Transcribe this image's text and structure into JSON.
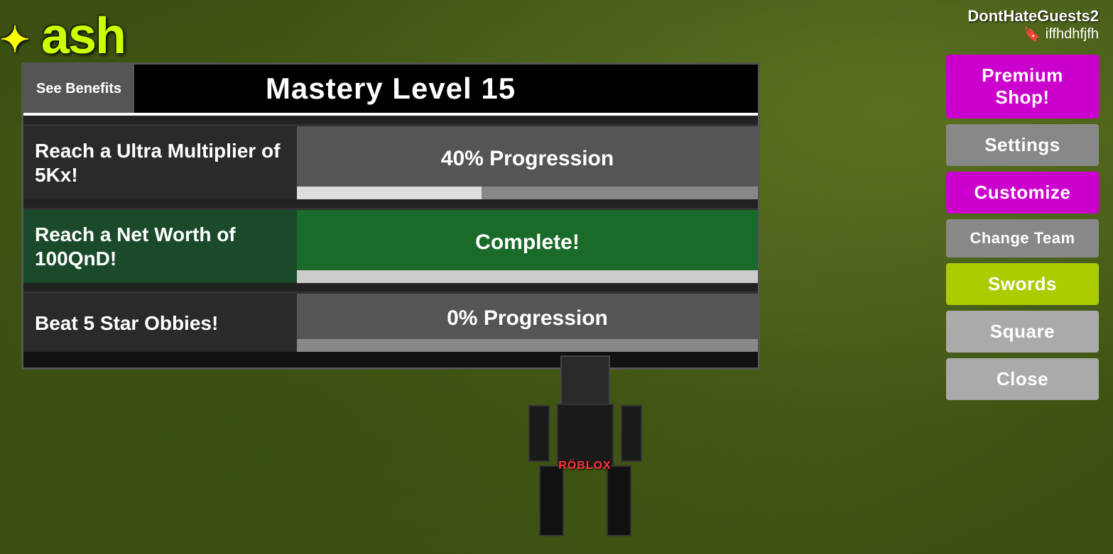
{
  "background": {
    "color": "#4a5e1a"
  },
  "top_left": {
    "label": "ash",
    "sparkle": "✦"
  },
  "mastery_panel": {
    "title": "Mastery Level 15",
    "see_benefits_label": "See Benefits",
    "objectives": [
      {
        "label": "Reach a Ultra Multiplier of 5Kx!",
        "status": "40% Progression",
        "progress_pct": 40,
        "complete": false
      },
      {
        "label": "Reach a Net Worth of 100QnD!",
        "status": "Complete!",
        "progress_pct": 100,
        "complete": true
      },
      {
        "label": "Beat 5 Star Obbies!",
        "status": "0% Progression",
        "progress_pct": 0,
        "complete": false
      }
    ]
  },
  "right_panel": {
    "username": "DontHateGuests2",
    "bookmark_text": "iffhdhfjfh",
    "buttons": [
      {
        "id": "premium-shop",
        "label": "Premium Shop!",
        "style": "premium"
      },
      {
        "id": "settings",
        "label": "Settings",
        "style": "settings"
      },
      {
        "id": "customize",
        "label": "Customize",
        "style": "customize"
      },
      {
        "id": "change-team",
        "label": "Change Team",
        "style": "change-team"
      },
      {
        "id": "swords",
        "label": "Swords",
        "style": "swords"
      },
      {
        "id": "square",
        "label": "Square",
        "style": "square"
      },
      {
        "id": "close",
        "label": "Close",
        "style": "close"
      }
    ]
  },
  "character": {
    "roblox_label": "RÖBLOX"
  }
}
